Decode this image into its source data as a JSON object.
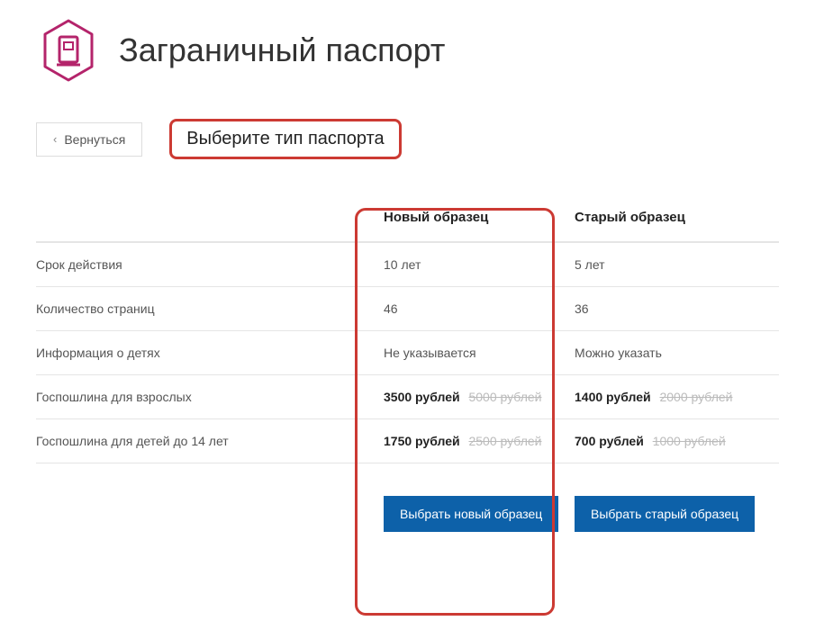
{
  "header": {
    "title": "Заграничный паспорт",
    "back_label": "Вернуться",
    "subtitle": "Выберите тип паспорта"
  },
  "columns": {
    "new_label": "Новый образец",
    "old_label": "Старый образец"
  },
  "rows": {
    "validity": {
      "label": "Срок действия",
      "new": "10 лет",
      "old": "5 лет"
    },
    "pages": {
      "label": "Количество страниц",
      "new": "46",
      "old": "36"
    },
    "children_info": {
      "label": "Информация о детях",
      "new": "Не указывается",
      "old": "Можно указать"
    },
    "fee_adult": {
      "label": "Госпошлина для взрослых",
      "new_price": "3500 рублей",
      "new_old_price": "5000 рублей",
      "old_price": "1400 рублей",
      "old_old_price": "2000 рублей"
    },
    "fee_child": {
      "label": "Госпошлина для детей до 14 лет",
      "new_price": "1750 рублей",
      "new_old_price": "2500 рублей",
      "old_price": "700 рублей",
      "old_old_price": "1000 рублей"
    }
  },
  "actions": {
    "select_new": "Выбрать новый образец",
    "select_old": "Выбрать старый образец"
  }
}
